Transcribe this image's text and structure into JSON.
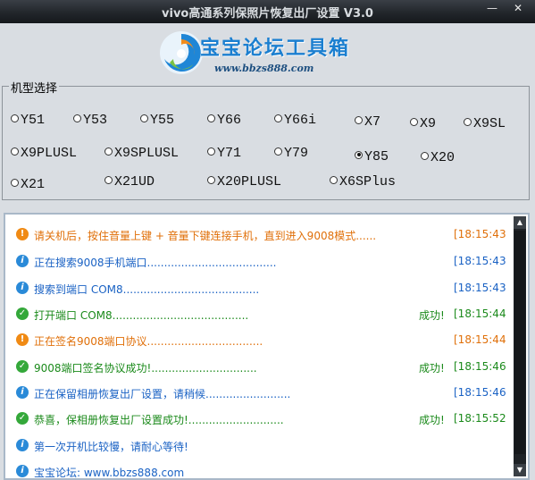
{
  "window": {
    "title": "vivo高通系列保照片恢复出厂设置 V3.0",
    "minimize_label": "—",
    "close_label": "✕"
  },
  "logo": {
    "brand": "宝宝论坛工具箱",
    "url": "www.bbzs888.com"
  },
  "model_group": {
    "legend": "机型选择",
    "selected": "Y85",
    "options": [
      "Y51",
      "Y53",
      "Y55",
      "Y66",
      "Y66i",
      "X7",
      "X9",
      "X9SL",
      "X9PLUSL",
      "X9SPLUSL",
      "Y71",
      "Y79",
      "Y85",
      "X20",
      "X21",
      "X21UD",
      "X20PLUSL",
      "X6SPlus"
    ]
  },
  "log": {
    "entries": [
      {
        "type": "warn",
        "message": "请关机后，按住音量上键 + 音量下键连接手机，直到进入9008模式......",
        "result": "",
        "time": "[18:15:43"
      },
      {
        "type": "info",
        "message": "正在搜索9008手机端口......................................",
        "result": "",
        "time": "[18:15:43"
      },
      {
        "type": "info",
        "message": "搜索到端口 COM8........................................",
        "result": "",
        "time": "[18:15:43"
      },
      {
        "type": "ok",
        "message": "打开端口 COM8........................................",
        "result": "成功!",
        "time": "[18:15:44"
      },
      {
        "type": "warn",
        "message": "正在签名9008端口协议..................................",
        "result": "",
        "time": "[18:15:44"
      },
      {
        "type": "ok",
        "message": "9008端口签名协议成功!...............................",
        "result": "成功!",
        "time": "[18:15:46"
      },
      {
        "type": "info",
        "message": "正在保留相册恢复出厂设置，请稍候.........................",
        "result": "",
        "time": "[18:15:46"
      },
      {
        "type": "ok",
        "message": "恭喜，保相册恢复出厂设置成功!............................",
        "result": "成功!",
        "time": "[18:15:52"
      },
      {
        "type": "info",
        "message": "第一次开机比较慢，请耐心等待!",
        "result": "",
        "time": ""
      },
      {
        "type": "info",
        "message": "宝宝论坛: www.bbzs888.com",
        "result": "",
        "time": ""
      }
    ]
  },
  "colors": {
    "warn": "#e0700a",
    "info": "#1a62c4",
    "ok": "#1b8a1b"
  },
  "icons": {
    "warn": "exclamation-circle-icon",
    "info": "info-circle-icon",
    "ok": "check-circle-icon"
  }
}
